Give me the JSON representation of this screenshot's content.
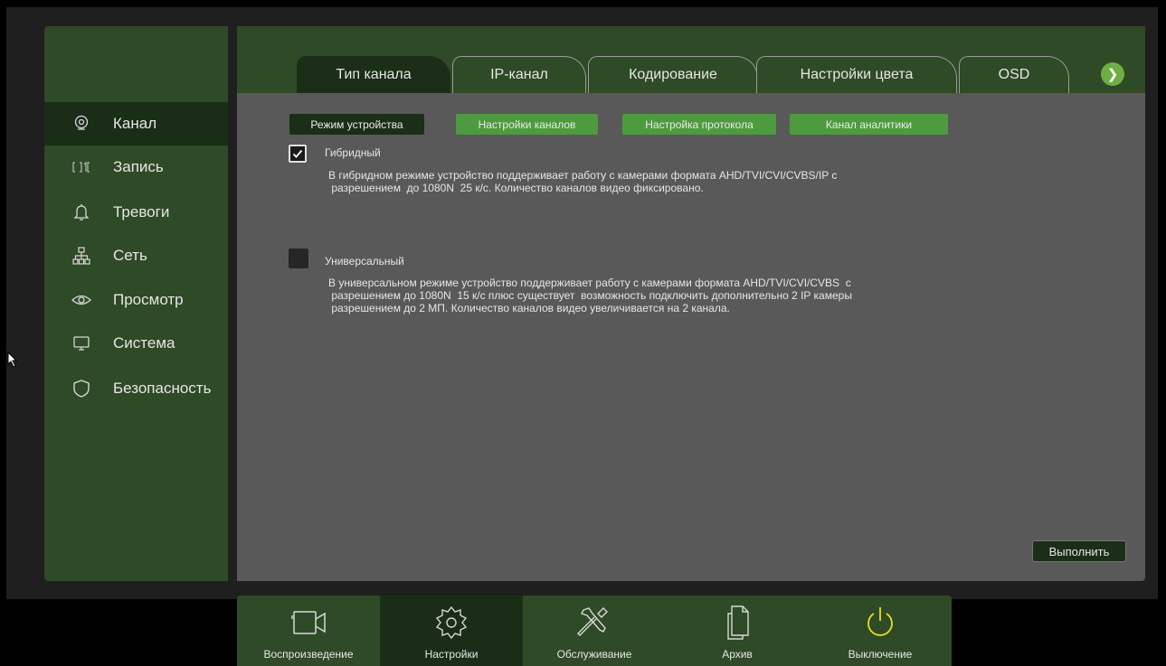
{
  "sidebar": {
    "items": [
      {
        "label": "Канал",
        "icon": "camera-icon",
        "active": true
      },
      {
        "label": "Запись",
        "icon": "record-icon",
        "active": false
      },
      {
        "label": "Тревоги",
        "icon": "bell-icon",
        "active": false
      },
      {
        "label": "Сеть",
        "icon": "network-icon",
        "active": false
      },
      {
        "label": "Просмотр",
        "icon": "eye-icon",
        "active": false
      },
      {
        "label": "Система",
        "icon": "monitor-icon",
        "active": false
      },
      {
        "label": "Безопасность",
        "icon": "shield-icon",
        "active": false
      }
    ]
  },
  "tabs": [
    {
      "label": "Тип канала",
      "active": true
    },
    {
      "label": "IP-канал",
      "active": false
    },
    {
      "label": "Кодирование",
      "active": false
    },
    {
      "label": "Настройки цвета",
      "active": false
    },
    {
      "label": "OSD",
      "active": false
    }
  ],
  "subtabs": [
    {
      "label": "Режим устройства",
      "active": true
    },
    {
      "label": "Настройки каналов",
      "active": false
    },
    {
      "label": "Настройка протокола",
      "active": false
    },
    {
      "label": "Канал аналитики",
      "active": false
    }
  ],
  "options": {
    "hybrid": {
      "label": "Гибридный",
      "checked": true,
      "description": "В гибридном режиме устройство поддерживает работу с камерами формата AHD/TVI/CVI/CVBS/IP с\n разрешением  до 1080N  25 к/с. Количество каналов видео фиксировано."
    },
    "universal": {
      "label": "Универсальный",
      "checked": false,
      "description": "В универсальном режиме устройство поддерживает работу с камерами формата AHD/TVI/CVI/CVBS  с\n разрешением до 1080N  15 к/с плюс существует  возможность подключить дополнительно 2 IP камеры\n разрешением до 2 МП. Количество каналов видео увеличивается на 2 канала."
    }
  },
  "execute_label": "Выполнить",
  "bottom": [
    {
      "label": "Воспроизведение",
      "icon": "video-camera-icon",
      "active": false
    },
    {
      "label": "Настройки",
      "icon": "gear-icon",
      "active": true
    },
    {
      "label": "Обслуживание",
      "icon": "tools-icon",
      "active": false
    },
    {
      "label": "Архив",
      "icon": "copy-files-icon",
      "active": false
    },
    {
      "label": "Выключение",
      "icon": "power-icon",
      "active": false
    }
  ],
  "colors": {
    "panel_green": "#2f4a26",
    "active_dark": "#1b2e18",
    "subtab_green": "#4e9a3e",
    "content_gray": "#595959",
    "power_yellow": "#e8e020",
    "next_button": "#6fae45"
  }
}
